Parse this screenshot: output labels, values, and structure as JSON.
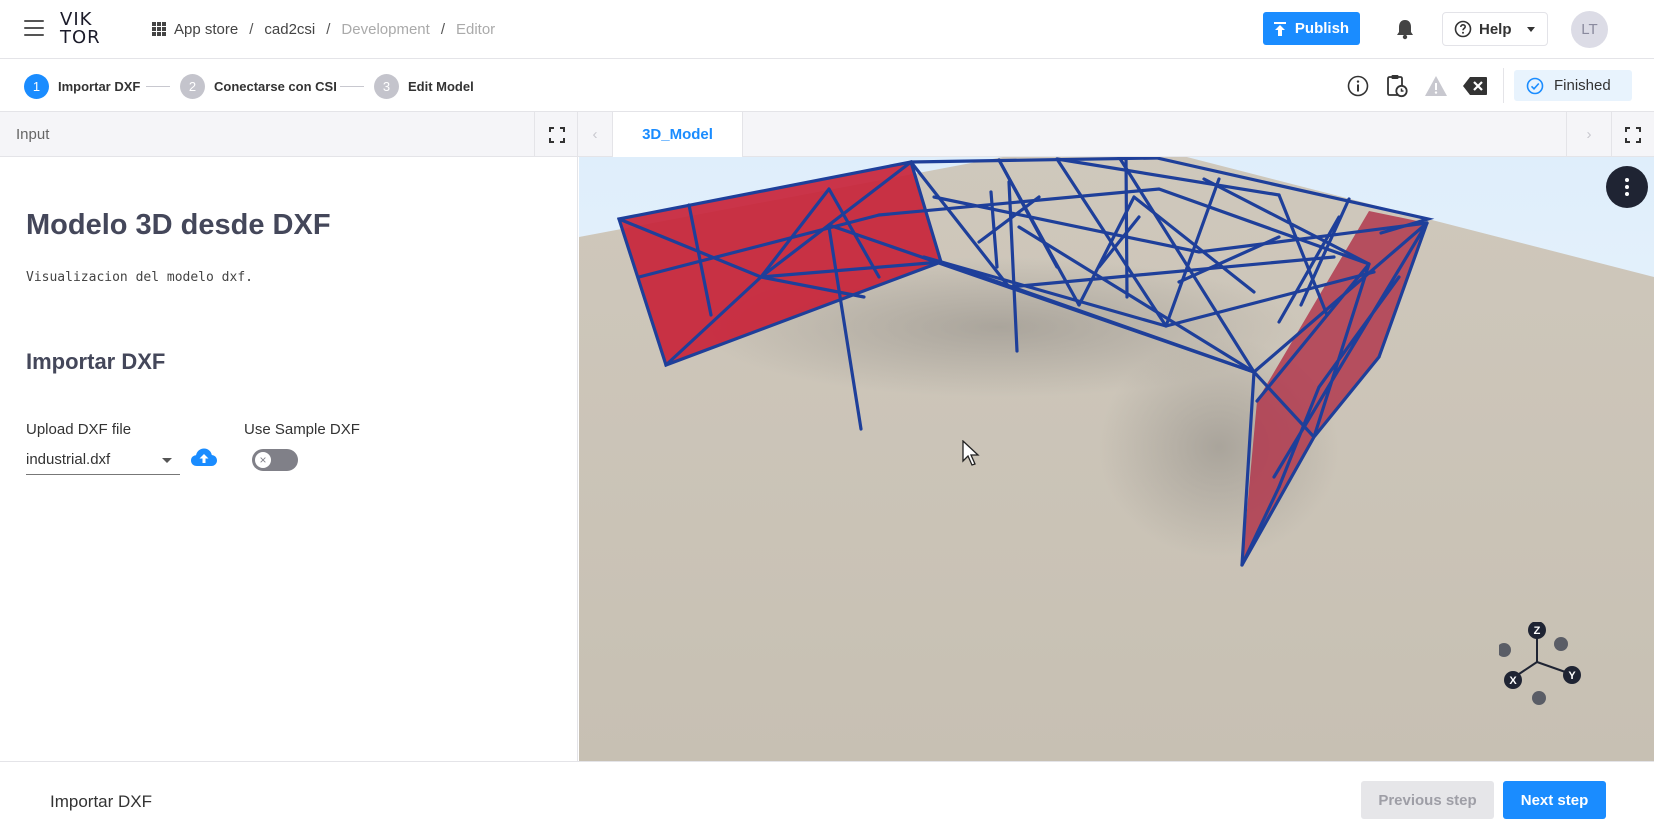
{
  "header": {
    "logo_line1": "VIK",
    "logo_line2": "TOR",
    "breadcrumb": [
      "App store",
      "cad2csi",
      "Development",
      "Editor"
    ],
    "publish_label": "Publish",
    "help_label": "Help",
    "avatar_initials": "LT"
  },
  "steps": [
    {
      "number": "1",
      "label": "Importar DXF",
      "active": true
    },
    {
      "number": "2",
      "label": "Conectarse con CSI",
      "active": false
    },
    {
      "number": "3",
      "label": "Edit Model",
      "active": false
    }
  ],
  "status": {
    "label": "Finished",
    "color": "#1a8cff"
  },
  "input_panel": {
    "header": "Input",
    "title": "Modelo 3D desde DXF",
    "description": "Visualizacion del modelo dxf.",
    "section_title": "Importar DXF",
    "upload_label": "Upload DXF file",
    "upload_value": "industrial.dxf",
    "sample_label": "Use Sample DXF",
    "sample_enabled": false
  },
  "view_panel": {
    "tab": "3D_Model",
    "axes": {
      "z": "Z",
      "y": "Y",
      "x": "X"
    }
  },
  "footer": {
    "current_step": "Importar DXF",
    "prev_label": "Previous step",
    "next_label": "Next step"
  },
  "colors": {
    "accent": "#1a8cff",
    "frame": "#1e3f9a",
    "panel": "#c8243a",
    "ground": "#c9c2b5"
  }
}
